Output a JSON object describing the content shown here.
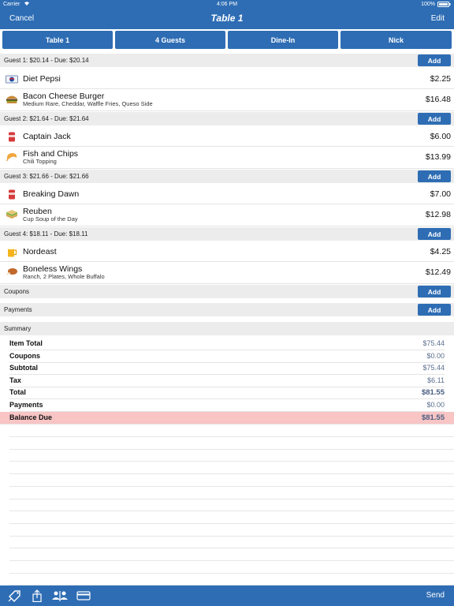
{
  "status": {
    "carrier": "Carrier",
    "time": "4:06 PM",
    "battery": "100%"
  },
  "nav": {
    "cancel": "Cancel",
    "title": "Table 1",
    "edit": "Edit"
  },
  "segments": [
    "Table 1",
    "4 Guests",
    "Dine-In",
    "Nick"
  ],
  "add_label": "Add",
  "guests": [
    {
      "header": "Guest 1: $20.14 - Due: $20.14",
      "items": [
        {
          "icon": "pepsi-can-icon",
          "name": "Diet Pepsi",
          "mods": "",
          "price": "$2.25"
        },
        {
          "icon": "burger-icon",
          "name": "Bacon Cheese Burger",
          "mods": "Medium Rare, Cheddar, Waffle Fries, Queso Side",
          "price": "$16.48"
        }
      ]
    },
    {
      "header": "Guest 2: $21.64 - Due: $21.64",
      "items": [
        {
          "icon": "soda-can-icon",
          "name": "Captain Jack",
          "mods": "",
          "price": "$6.00"
        },
        {
          "icon": "shrimp-icon",
          "name": "Fish and Chips",
          "mods": "Chili Topping",
          "price": "$13.99"
        }
      ]
    },
    {
      "header": "Guest 3: $21.66 - Due: $21.66",
      "items": [
        {
          "icon": "soda-can-icon",
          "name": "Breaking Dawn",
          "mods": "",
          "price": "$7.00"
        },
        {
          "icon": "sandwich-icon",
          "name": "Reuben",
          "mods": "Cup Soup of the Day",
          "price": "$12.98"
        }
      ]
    },
    {
      "header": "Guest 4: $18.11 - Due: $18.11",
      "items": [
        {
          "icon": "beer-mug-icon",
          "name": "Nordeast",
          "mods": "",
          "price": "$4.25"
        },
        {
          "icon": "chicken-wing-icon",
          "name": "Boneless Wings",
          "mods": "Ranch, 2 Plates, Whole Buffalo",
          "price": "$12.49"
        }
      ]
    }
  ],
  "coupons_label": "Coupons",
  "payments_label": "Payments",
  "summary": {
    "header": "Summary",
    "rows": [
      {
        "label": "Item Total",
        "value": "$75.44"
      },
      {
        "label": "Coupons",
        "value": "$0.00"
      },
      {
        "label": "Subtotal",
        "value": "$75.44"
      },
      {
        "label": "Tax",
        "value": "$6.11"
      },
      {
        "label": "Total",
        "value": "$81.55"
      },
      {
        "label": "Payments",
        "value": "$0.00"
      },
      {
        "label": "Balance Due",
        "value": "$81.55"
      }
    ]
  },
  "toolbar": {
    "send": "Send",
    "icons": [
      "discount-tag-icon",
      "share-icon",
      "split-guests-icon",
      "credit-card-icon"
    ]
  },
  "colors": {
    "brand": "#2e6db4",
    "balance_due_bg": "#f8c4c4",
    "header_bg": "#ececec"
  }
}
